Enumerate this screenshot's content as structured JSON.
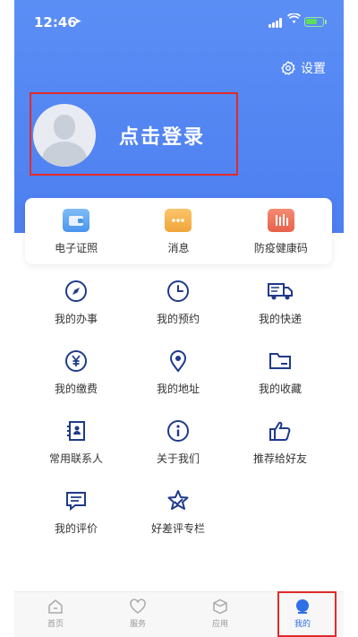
{
  "status_bar": {
    "time": "12:46"
  },
  "header": {
    "settings_label": "设置",
    "login_label": "点击登录"
  },
  "quick_actions": [
    {
      "label": "电子证照",
      "icon": "wallet-icon",
      "color": "#5aa5f5"
    },
    {
      "label": "消息",
      "icon": "message-icon",
      "color": "#f5b34a"
    },
    {
      "label": "防疫健康码",
      "icon": "health-code-icon",
      "color": "#f0705a"
    }
  ],
  "menu": [
    {
      "label": "我的办事",
      "icon": "compass-icon"
    },
    {
      "label": "我的预约",
      "icon": "clock-icon"
    },
    {
      "label": "我的快递",
      "icon": "truck-icon"
    },
    {
      "label": "我的缴费",
      "icon": "yuan-icon"
    },
    {
      "label": "我的地址",
      "icon": "location-icon"
    },
    {
      "label": "我的收藏",
      "icon": "folder-icon"
    },
    {
      "label": "常用联系人",
      "icon": "contact-card-icon"
    },
    {
      "label": "关于我们",
      "icon": "info-icon"
    },
    {
      "label": "推荐给好友",
      "icon": "thumbs-up-icon"
    },
    {
      "label": "我的评价",
      "icon": "comment-icon"
    },
    {
      "label": "好差评专栏",
      "icon": "star-badge-icon"
    }
  ],
  "tabbar": [
    {
      "label": "首页",
      "icon": "home-icon"
    },
    {
      "label": "服务",
      "icon": "heart-icon"
    },
    {
      "label": "应用",
      "icon": "cube-icon"
    },
    {
      "label": "我的",
      "icon": "profile-icon",
      "active": true
    }
  ],
  "colors": {
    "primary": "#4d7ff0",
    "icon_dark": "#1f3a8a",
    "highlight": "#e12a2a"
  }
}
